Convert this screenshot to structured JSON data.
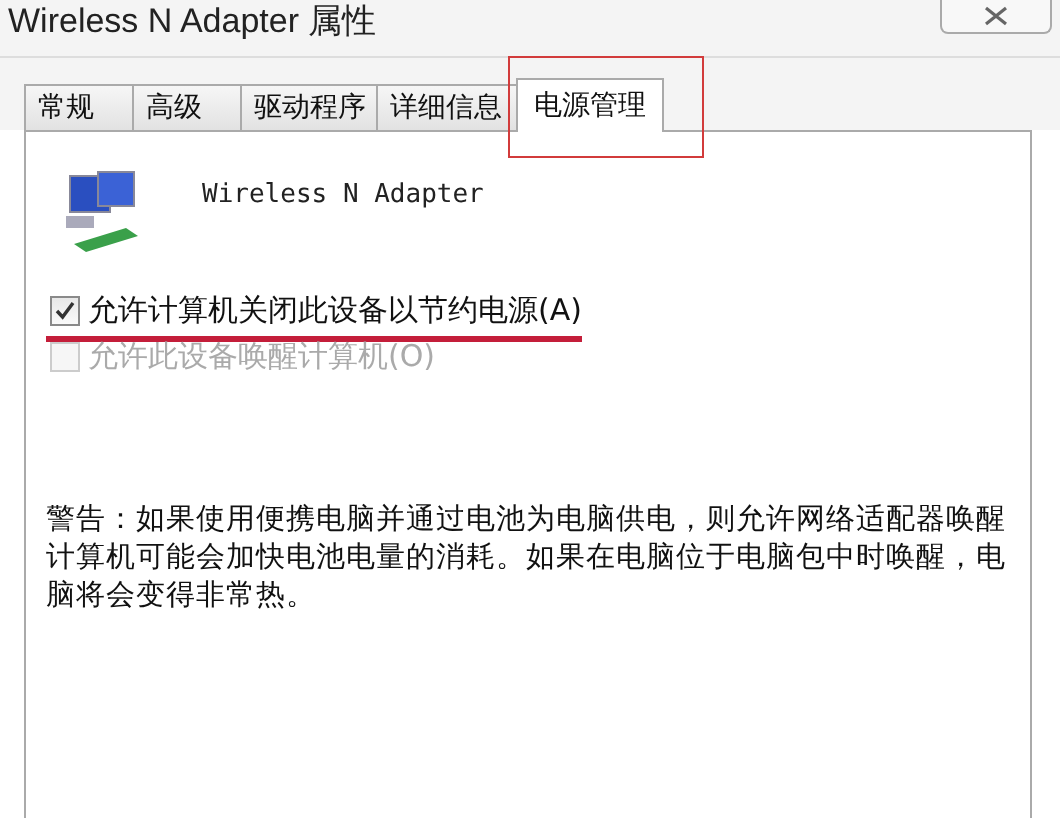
{
  "window": {
    "title": "Wireless N Adapter 属性"
  },
  "tabs": [
    {
      "label": "常规",
      "selected": false
    },
    {
      "label": "高级",
      "selected": false
    },
    {
      "label": "驱动程序",
      "selected": false
    },
    {
      "label": "详细信息",
      "selected": false
    },
    {
      "label": "电源管理",
      "selected": true
    }
  ],
  "device": {
    "name": "Wireless N Adapter"
  },
  "options": [
    {
      "label": "允许计算机关闭此设备以节约电源(A)",
      "checked": true,
      "disabled": false
    },
    {
      "label": "允许此设备唤醒计算机(O)",
      "checked": false,
      "disabled": true
    }
  ],
  "warning": "警告：如果使用便携电脑并通过电池为电脑供电，则允许网络适配器唤醒计算机可能会加快电池电量的消耗。如果在电脑位于电脑包中时唤醒，电脑将会变得非常热。"
}
